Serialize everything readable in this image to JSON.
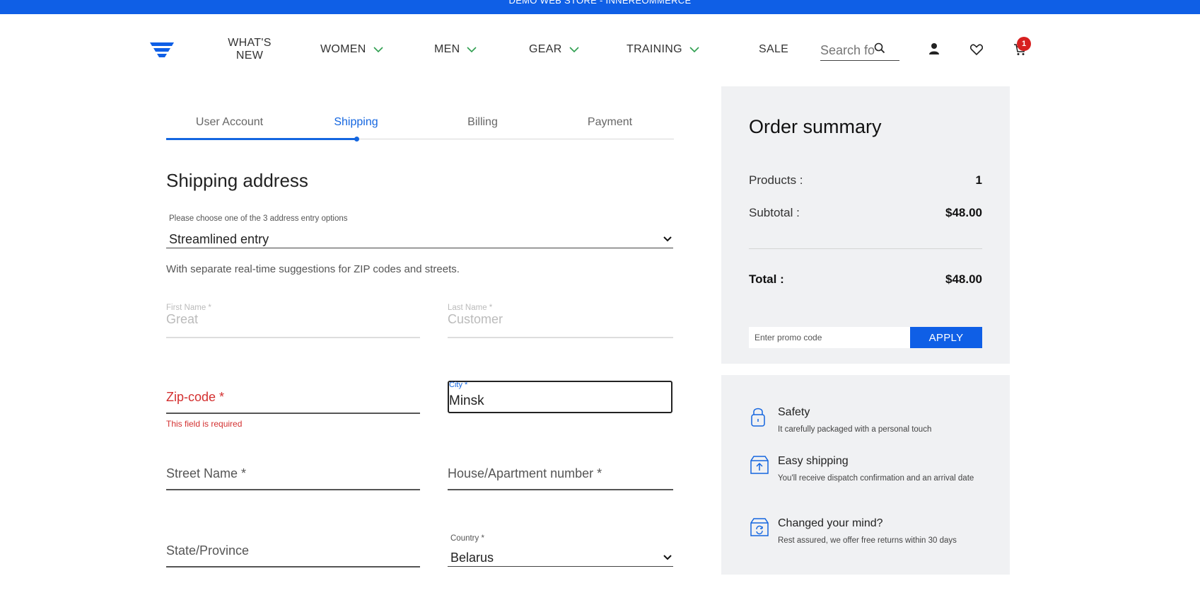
{
  "topbar": {
    "text": "DEMO WEB STORE - INNEREOMMERCE"
  },
  "nav": {
    "whats_new_line1": "WHAT'S",
    "whats_new_line2": "NEW",
    "women": "WOMEN",
    "men": "MEN",
    "gear": "GEAR",
    "training": "TRAINING",
    "sale": "SALE",
    "search_placeholder": "Search fo",
    "cart_count": "1"
  },
  "steps": [
    {
      "label": "User Account"
    },
    {
      "label": "Shipping"
    },
    {
      "label": "Billing"
    },
    {
      "label": "Payment"
    }
  ],
  "form": {
    "title": "Shipping address",
    "entry_label": "Please choose one of the 3 address entry options",
    "entry_value": "Streamlined entry",
    "entry_hint": "With separate real-time suggestions for ZIP codes and streets.",
    "first_name_label": "First Name *",
    "first_name_value": "Great",
    "last_name_label": "Last Name *",
    "last_name_value": "Customer",
    "zip_placeholder": "Zip-code *",
    "zip_error": "This field is required",
    "city_label": "City *",
    "city_value": "Minsk",
    "street_placeholder": "Street Name *",
    "house_placeholder": "House/Apartment number *",
    "state_placeholder": "State/Province",
    "country_label": "Country *",
    "country_value": "Belarus"
  },
  "summary": {
    "title": "Order summary",
    "products_label": "Products :",
    "products_value": "1",
    "subtotal_label": "Subtotal :",
    "subtotal_value": "$48.00",
    "total_label": "Total :",
    "total_value": "$48.00",
    "promo_placeholder": "Enter promo code",
    "apply_label": "APPLY"
  },
  "perks": [
    {
      "title": "Safety",
      "desc": "It carefully packaged with a personal touch"
    },
    {
      "title": "Easy shipping",
      "desc": "You'll receive dispatch confirmation and an arrival date"
    },
    {
      "title": "Changed your mind?",
      "desc": "Rest assured, we offer free returns within 30 days"
    }
  ],
  "colors": {
    "accent": "#0f5fe6",
    "error": "#d32f2f",
    "panel": "#f0f1f3",
    "chevron": "#2e9e4f"
  }
}
